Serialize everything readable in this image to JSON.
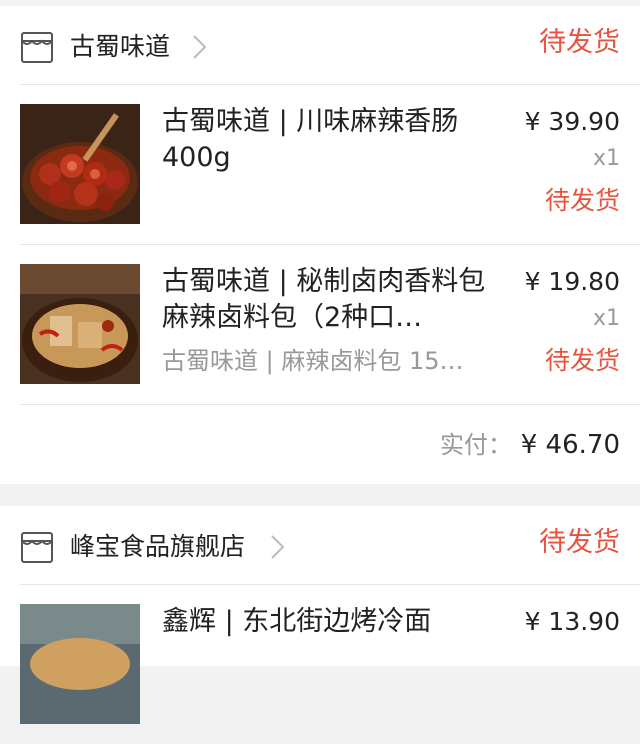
{
  "order1": {
    "shop": {
      "name": "古蜀味道",
      "status": "待发货",
      "icon": "shop-icon"
    },
    "items": [
      {
        "title": "古蜀味道 | 川味麻辣香肠400g",
        "subtitle": "",
        "price": "¥ 39.90",
        "qty": "x1",
        "status": "待发货"
      },
      {
        "title": "古蜀味道 | 秘制卤肉香料包 麻辣卤料包（2种口…",
        "subtitle": "古蜀味道 | 麻辣卤料包 15…",
        "price": "¥ 19.80",
        "qty": "x1",
        "status": "待发货"
      }
    ],
    "total_label": "实付：",
    "total_value": "¥ 46.70"
  },
  "order2": {
    "shop": {
      "name": "峰宝食品旗舰店",
      "status": "待发货",
      "icon": "shop-icon"
    },
    "items": [
      {
        "title": "鑫辉 | 东北街边烤冷面",
        "price": "¥ 13.90"
      }
    ]
  },
  "colors": {
    "accent": "#e8533f",
    "muted": "#999999",
    "text": "#222222",
    "background": "#f2f2f2"
  }
}
